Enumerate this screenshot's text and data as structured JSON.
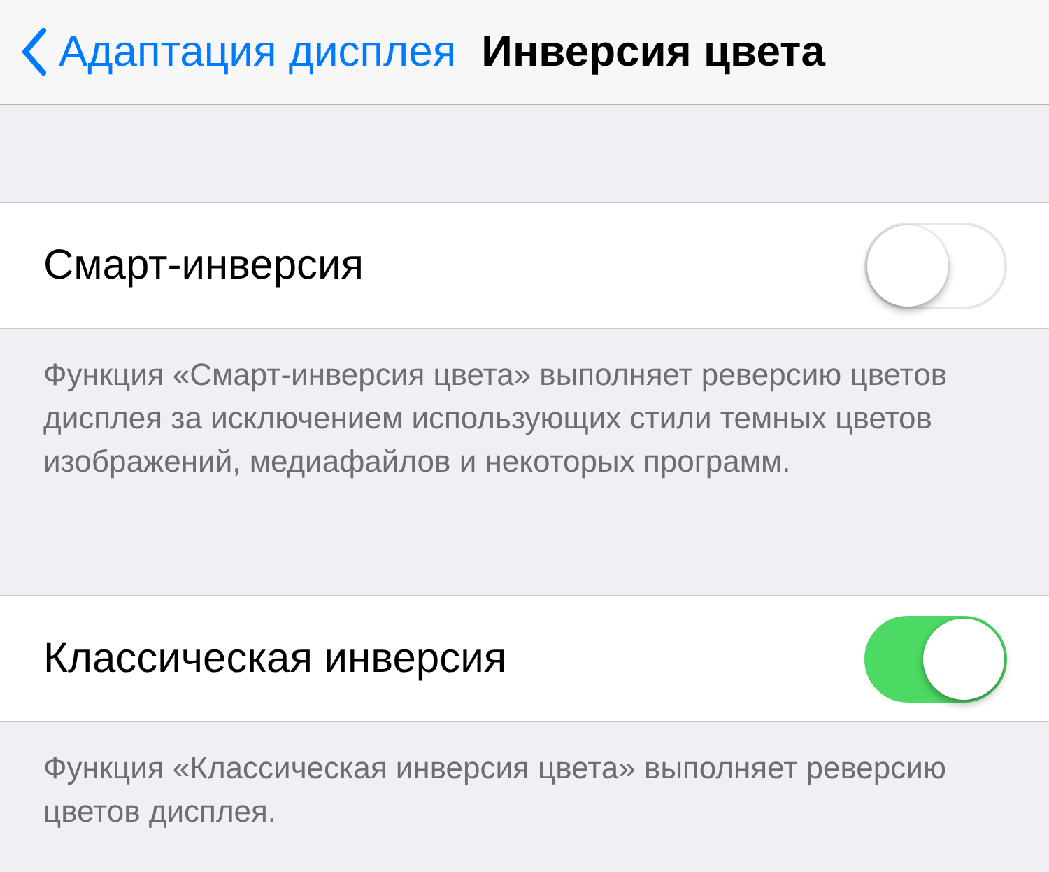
{
  "nav": {
    "back_label": "Адаптация дисплея",
    "title": "Инверсия цвета"
  },
  "sections": [
    {
      "label": "Смарт-инверсия",
      "on": false,
      "footer": "Функция «Смарт-инверсия цвета» выполняет реверсию цветов дисплея за исключением использующих стили темных цветов изображений, медиафайлов и некоторых программ."
    },
    {
      "label": "Классическая инверсия",
      "on": true,
      "footer": "Функция «Классическая инверсия цвета» выполняет реверсию цветов дисплея."
    }
  ]
}
